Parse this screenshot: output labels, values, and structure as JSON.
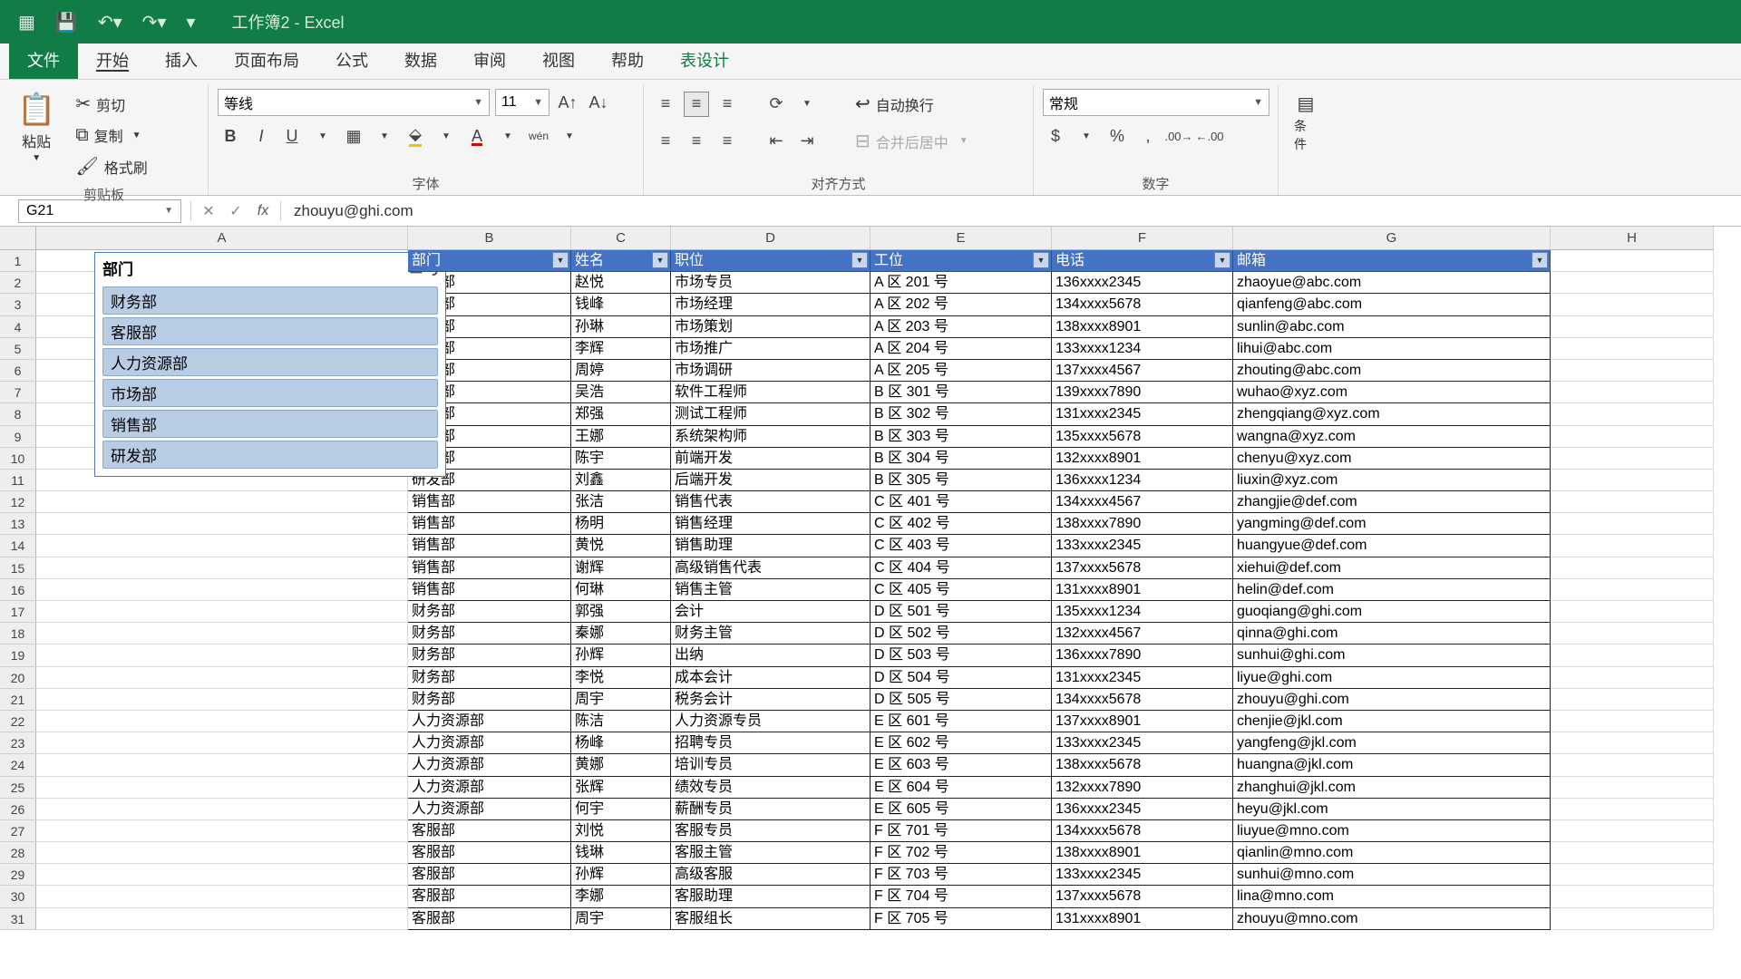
{
  "app": {
    "title": "工作簿2  -  Excel"
  },
  "menu": {
    "file": "文件",
    "home": "开始",
    "insert": "插入",
    "pageLayout": "页面布局",
    "formulas": "公式",
    "data": "数据",
    "review": "审阅",
    "view": "视图",
    "help": "帮助",
    "tableDesign": "表设计"
  },
  "ribbon": {
    "clipboard": {
      "paste": "粘贴",
      "cut": "剪切",
      "copy": "复制",
      "formatPainter": "格式刷",
      "group": "剪贴板"
    },
    "font": {
      "name": "等线",
      "size": "11",
      "group": "字体"
    },
    "align": {
      "wrap": "自动换行",
      "merge": "合并后居中",
      "group": "对齐方式"
    },
    "number": {
      "format": "常规",
      "group": "数字"
    },
    "cond": "条件"
  },
  "formulaBar": {
    "nameBox": "G21",
    "fx": "fx",
    "value": "zhouyu@ghi.com"
  },
  "columns": [
    "A",
    "B",
    "C",
    "D",
    "E",
    "F",
    "G",
    "H"
  ],
  "slicer": {
    "title": "部门",
    "items": [
      "财务部",
      "客服部",
      "人力资源部",
      "市场部",
      "销售部",
      "研发部"
    ]
  },
  "table": {
    "headers": [
      "部门",
      "姓名",
      "职位",
      "工位",
      "电话",
      "邮箱"
    ],
    "rows": [
      [
        "市场部",
        "赵悦",
        "市场专员",
        "A 区 201 号",
        "136xxxx2345",
        "zhaoyue@abc.com"
      ],
      [
        "市场部",
        "钱峰",
        "市场经理",
        "A 区 202 号",
        "134xxxx5678",
        "qianfeng@abc.com"
      ],
      [
        "市场部",
        "孙琳",
        "市场策划",
        "A 区 203 号",
        "138xxxx8901",
        "sunlin@abc.com"
      ],
      [
        "市场部",
        "李辉",
        "市场推广",
        "A 区 204 号",
        "133xxxx1234",
        "lihui@abc.com"
      ],
      [
        "市场部",
        "周婷",
        "市场调研",
        "A 区 205 号",
        "137xxxx4567",
        "zhouting@abc.com"
      ],
      [
        "研发部",
        "吴浩",
        "软件工程师",
        "B 区 301 号",
        "139xxxx7890",
        "wuhao@xyz.com"
      ],
      [
        "研发部",
        "郑强",
        "测试工程师",
        "B 区 302 号",
        "131xxxx2345",
        "zhengqiang@xyz.com"
      ],
      [
        "研发部",
        "王娜",
        "系统架构师",
        "B 区 303 号",
        "135xxxx5678",
        "wangna@xyz.com"
      ],
      [
        "研发部",
        "陈宇",
        "前端开发",
        "B 区 304 号",
        "132xxxx8901",
        "chenyu@xyz.com"
      ],
      [
        "研发部",
        "刘鑫",
        "后端开发",
        "B 区 305 号",
        "136xxxx1234",
        "liuxin@xyz.com"
      ],
      [
        "销售部",
        "张洁",
        "销售代表",
        "C 区 401 号",
        "134xxxx4567",
        "zhangjie@def.com"
      ],
      [
        "销售部",
        "杨明",
        "销售经理",
        "C 区 402 号",
        "138xxxx7890",
        "yangming@def.com"
      ],
      [
        "销售部",
        "黄悦",
        "销售助理",
        "C 区 403 号",
        "133xxxx2345",
        "huangyue@def.com"
      ],
      [
        "销售部",
        "谢辉",
        "高级销售代表",
        "C 区 404 号",
        "137xxxx5678",
        "xiehui@def.com"
      ],
      [
        "销售部",
        "何琳",
        "销售主管",
        "C 区 405 号",
        "131xxxx8901",
        "helin@def.com"
      ],
      [
        "财务部",
        "郭强",
        "会计",
        "D 区 501 号",
        "135xxxx1234",
        "guoqiang@ghi.com"
      ],
      [
        "财务部",
        "秦娜",
        "财务主管",
        "D 区 502 号",
        "132xxxx4567",
        "qinna@ghi.com"
      ],
      [
        "财务部",
        "孙辉",
        "出纳",
        "D 区 503 号",
        "136xxxx7890",
        "sunhui@ghi.com"
      ],
      [
        "财务部",
        "李悦",
        "成本会计",
        "D 区 504 号",
        "131xxxx2345",
        "liyue@ghi.com"
      ],
      [
        "财务部",
        "周宇",
        "税务会计",
        "D 区 505 号",
        "134xxxx5678",
        "zhouyu@ghi.com"
      ],
      [
        "人力资源部",
        "陈洁",
        "人力资源专员",
        "E 区 601 号",
        "137xxxx8901",
        "chenjie@jkl.com"
      ],
      [
        "人力资源部",
        "杨峰",
        "招聘专员",
        "E 区 602 号",
        "133xxxx2345",
        "yangfeng@jkl.com"
      ],
      [
        "人力资源部",
        "黄娜",
        "培训专员",
        "E 区 603 号",
        "138xxxx5678",
        "huangna@jkl.com"
      ],
      [
        "人力资源部",
        "张辉",
        "绩效专员",
        "E 区 604 号",
        "132xxxx7890",
        "zhanghui@jkl.com"
      ],
      [
        "人力资源部",
        "何宇",
        "薪酬专员",
        "E 区 605 号",
        "136xxxx2345",
        "heyu@jkl.com"
      ],
      [
        "客服部",
        "刘悦",
        "客服专员",
        "F 区 701 号",
        "134xxxx5678",
        "liuyue@mno.com"
      ],
      [
        "客服部",
        "钱琳",
        "客服主管",
        "F 区 702 号",
        "138xxxx8901",
        "qianlin@mno.com"
      ],
      [
        "客服部",
        "孙辉",
        "高级客服",
        "F 区 703 号",
        "133xxxx2345",
        "sunhui@mno.com"
      ],
      [
        "客服部",
        "李娜",
        "客服助理",
        "F 区 704 号",
        "137xxxx5678",
        "lina@mno.com"
      ],
      [
        "客服部",
        "周宇",
        "客服组长",
        "F 区 705 号",
        "131xxxx8901",
        "zhouyu@mno.com"
      ]
    ]
  }
}
